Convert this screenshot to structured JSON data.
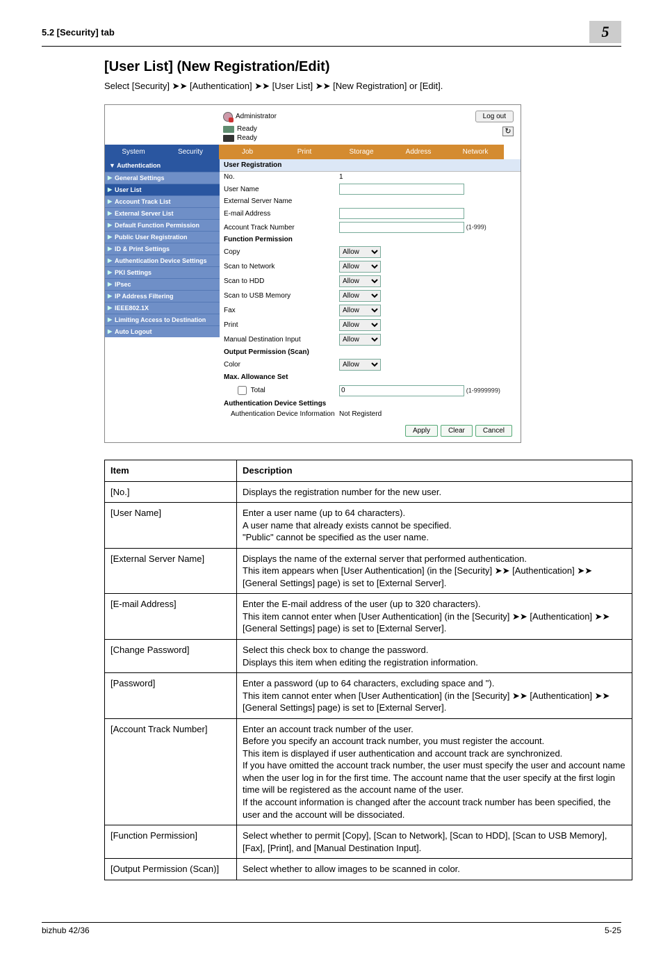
{
  "header": {
    "left": "5.2    [Security] tab",
    "right": "5"
  },
  "title": "[User List] (New Registration/Edit)",
  "lead_pre": "Select [Security] ",
  "lead_m1": "➤➤",
  "lead_mid1": " [Authentication] ",
  "lead_m2": "➤➤",
  "lead_mid2": " [User List] ",
  "lead_m3": "➤➤",
  "lead_post": " [New Registration] or [Edit].",
  "shot": {
    "admin": "Administrator",
    "logout": "Log out",
    "ready": "Ready",
    "tabs": {
      "system": "System",
      "security": "Security",
      "job": "Job",
      "print": "Print",
      "storage": "Storage",
      "address": "Address",
      "network": "Network"
    },
    "side_head": "▼ Authentication",
    "side": {
      "general": "General Settings",
      "userlist": "User List",
      "acctrack": "Account Track List",
      "extsrv": "External Server List",
      "deffunc": "Default Function Permission",
      "pubreg": "Public User Registration",
      "idprint": "ID & Print Settings",
      "authdev": "Authentication Device Settings",
      "pki": "PKI Settings",
      "ipsec": "IPsec",
      "ipfilt": "IP Address Filtering",
      "ieee": "IEEE802.1X",
      "limiting": "Limiting Access to Destination",
      "autologout": "Auto Logout"
    },
    "content": {
      "head": "User Registration",
      "no": "No.",
      "no_val": "1",
      "username": "User Name",
      "extsrv": "External Server Name",
      "email": "E-mail Address",
      "acctrackno": "Account Track Number",
      "acctrack_note": "(1-999)",
      "funcperm": "Function Permission",
      "copy": "Copy",
      "scan_net": "Scan to Network",
      "scan_hdd": "Scan to HDD",
      "scan_usb": "Scan to USB Memory",
      "fax": "Fax",
      "print": "Print",
      "manual": "Manual Destination Input",
      "outperm": "Output Permission (Scan)",
      "color": "Color",
      "allow": "Allow",
      "maxset": "Max. Allowance Set",
      "total": "Total",
      "total_val": "0",
      "total_note": "(1-9999999)",
      "authdevset": "Authentication Device Settings",
      "authdevinfo": "Authentication Device Information",
      "notreg": "Not Registerd",
      "apply": "Apply",
      "clear": "Clear",
      "cancel": "Cancel"
    }
  },
  "desc": {
    "h_item": "Item",
    "h_desc": "Description",
    "rows": [
      {
        "item": "[No.]",
        "desc": "Displays the registration number for the new user."
      },
      {
        "item": "[User Name]",
        "desc": "Enter a user name (up to 64 characters).\nA user name that already exists cannot be specified.\n\"Public\" cannot be specified as the user name."
      },
      {
        "item": "[External Server Name]",
        "desc": "Displays the name of the external server that performed authentication.\nThis item appears when [User Authentication] (in the [Security] ➤➤ [Authentication] ➤➤ [General Settings] page) is set to [External Server]."
      },
      {
        "item": "[E-mail Address]",
        "desc": "Enter the E-mail address of the user (up to 320 characters).\nThis item cannot enter when [User Authentication] (in the [Security] ➤➤ [Authentication] ➤➤ [General Settings] page) is set to [External Server]."
      },
      {
        "item": "[Change Password]",
        "desc": "Select this check box to change the password.\nDisplays this item when editing the registration information."
      },
      {
        "item": "[Password]",
        "desc": "Enter a password (up to 64 characters, excluding space and \").\nThis item cannot enter when [User Authentication] (in the [Security] ➤➤ [Authentication] ➤➤ [General Settings] page) is set to [External Server]."
      },
      {
        "item": "[Account Track Number]",
        "desc": "Enter an account track number of the user.\nBefore you specify an account track number, you must register the account.\nThis item is displayed if user authentication and account track are synchronized.\nIf you have omitted the account track number, the user must specify the user and account name when the user log in for the first time. The account name that the user specify at the first login time will be registered as the account name of the user.\nIf the account information is changed after the account track number has been specified, the user and the account will be dissociated."
      },
      {
        "item": "[Function Permission]",
        "desc": "Select whether to permit [Copy], [Scan to Network], [Scan to HDD], [Scan to USB Memory], [Fax], [Print], and [Manual Destination Input]."
      },
      {
        "item": "[Output Permission (Scan)]",
        "desc": "Select whether to allow images to be scanned in color."
      }
    ]
  },
  "footer": {
    "left": "bizhub 42/36",
    "right": "5-25"
  }
}
